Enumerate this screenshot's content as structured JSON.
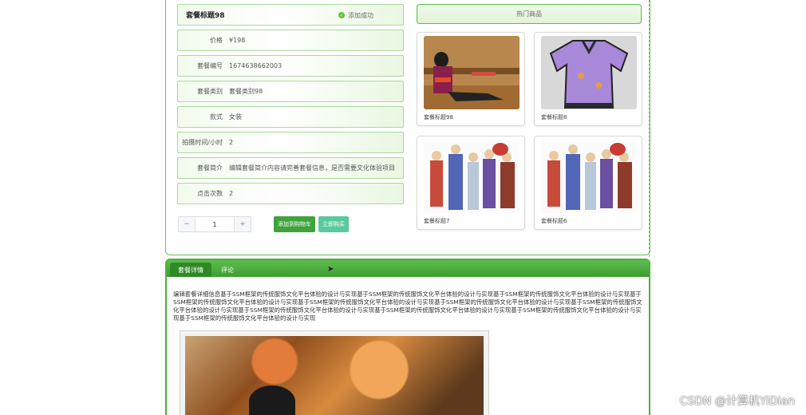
{
  "product": {
    "title": "套餐标题98",
    "rows": [
      {
        "label": "价格",
        "value": "¥198"
      },
      {
        "label": "套餐编号",
        "value": "1674638662003"
      },
      {
        "label": "套餐类别",
        "value": "套餐类别98"
      },
      {
        "label": "款式",
        "value": "女装"
      },
      {
        "label": "拍摄时间/小时",
        "value": "2"
      },
      {
        "label": "套餐简介",
        "value": "编辑套餐简介内容请完善套餐信息，是否需要文化体验项目"
      },
      {
        "label": "点击次数",
        "value": "2"
      }
    ]
  },
  "toast": {
    "text": "添加成功",
    "icon": "check-circle-icon"
  },
  "purchase": {
    "minus": "−",
    "quantity": "1",
    "plus": "+",
    "add_to_cart": "添加到购物车",
    "buy_now": "立即购买"
  },
  "hot": {
    "title": "热门商品",
    "items": [
      {
        "name": "套餐标题98",
        "image": "woman-in-ethnic-costume-sitting"
      },
      {
        "name": "套餐标题8",
        "image": "purple-embroidered-robe"
      },
      {
        "name": "套餐标题7",
        "image": "illustrated-costume-figures"
      },
      {
        "name": "套餐标题6",
        "image": "illustrated-costume-figures"
      }
    ]
  },
  "tabs": [
    {
      "label": "套餐详情",
      "active": true
    },
    {
      "label": "评论",
      "active": false
    }
  ],
  "detail": {
    "text": "编辑套餐详细信息基于SSM框架的传统服饰文化平台体验的设计与实现基于SSM框架的传统服饰文化平台体验的设计与实现基于SSM框架的传统服饰文化平台体验的设计与实现基于SSM框架的传统服饰文化平台体验的设计与实现基于SSM框架的传统服饰文化平台体验的设计与实现基于SSM框架的传统服饰文化平台体验的设计与实现基于SSM框架的传统服饰文化平台体验的设计与实现基于SSM框架的传统服饰文化平台体验的设计与实现基于SSM框架的传统服饰文化平台体验的设计与实现基于SSM框架的传统服饰文化平台体验的设计与实现基于SSM框架的传统服饰文化平台体验的设计与实现"
  },
  "watermark": "CSDN @计算机YiDian",
  "colors": {
    "accent": "#4eae3f",
    "cart": "#3fa33b",
    "buy": "#59c9a0"
  }
}
